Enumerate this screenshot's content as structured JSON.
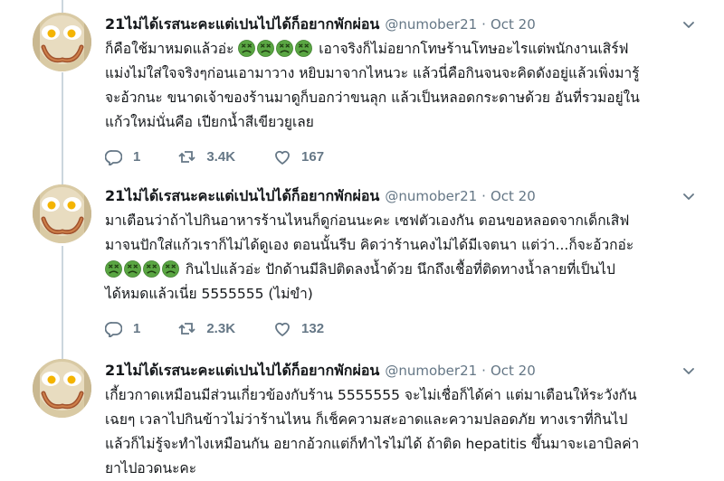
{
  "colors": {
    "text": "#14171a",
    "secondary": "#657786",
    "thread_line": "#ccd6dd"
  },
  "tweets": [
    {
      "name": "21ไม่ได้เรสนะคะแต่เปนไปได้ก็อยากพักผ่อน",
      "handle": "@numober21",
      "date": "Oct 20",
      "lines": [
        {
          "before": "ก็คือใช้มาหมดแล้วอ่ะ ",
          "emoji_count": 4,
          "after": " เอาจริงก็ไม่อยากโทษร้านโทษอะไรแต่พนักงานเสิร์ฟ"
        },
        {
          "before": "แม่งไม่ใส่ใจจริงๆก่อนเอามาวาง หยิบมาจากไหนวะ แล้วนี่คือกินจนจะคิดดังอยู่แล้วเพิ่งมารู้",
          "emoji_count": 0,
          "after": ""
        },
        {
          "before": "จะอ้วกนะ ขนาดเจ้าของร้านมาดูก็บอกว่าขนลุก แล้วเป็นหลอดกระดาษด้วย อันที่รวมอยู่ใน",
          "emoji_count": 0,
          "after": ""
        },
        {
          "before": "แก้วใหม่นั่นคือ เปียกน้ำสีเขียวยูเลย",
          "emoji_count": 0,
          "after": ""
        }
      ],
      "replies": "1",
      "retweets": "3.4K",
      "likes": "167"
    },
    {
      "name": "21ไม่ได้เรสนะคะแต่เปนไปได้ก็อยากพักผ่อน",
      "handle": "@numober21",
      "date": "Oct 20",
      "lines": [
        {
          "before": "มาเตือนว่าถ้าไปกินอาหารร้านไหนก็ดูก่อนนะคะ เซฟตัวเองกัน ตอนขอหลอดจากเด็กเสิฟ",
          "emoji_count": 0,
          "after": ""
        },
        {
          "before": "มาจนปักใส่แก้วเราก็ไม่ได้ดูเอง ตอนนั้นรีบ คิดว่าร้านคงไม่ได้มีเจตนา แต่ว่า...ก็จะอ้วกอ่ะ",
          "emoji_count": 0,
          "after": ""
        },
        {
          "before": "",
          "emoji_count": 4,
          "after": " กินไปแล้วอ่ะ ปักด้านมีลิปติดลงน้ำด้วย นึกถึงเชื้อที่ติดทางน้ำลายที่เป็นไป"
        },
        {
          "before": "ได้หมดแล้วเนี่ย 5555555 (ไม่ขำ)",
          "emoji_count": 0,
          "after": ""
        }
      ],
      "replies": "1",
      "retweets": "2.3K",
      "likes": "132"
    },
    {
      "name": "21ไม่ได้เรสนะคะแต่เปนไปได้ก็อยากพักผ่อน",
      "handle": "@numober21",
      "date": "Oct 20",
      "lines": [
        {
          "before": "เกี้ยวกาดเหมือนมีส่วนเกี่ยวข้องกับร้าน 5555555 จะไม่เชื่อก็ได้ค่า แต่มาเตือนให้ระวังกัน",
          "emoji_count": 0,
          "after": ""
        },
        {
          "before": "เฉยๆ เวลาไปกินข้าวไม่ว่าร้านไหน ก็เช็คความสะอาดและความปลอดภัย ทางเราที่กินไป",
          "emoji_count": 0,
          "after": ""
        },
        {
          "before": "แล้วก็ไม่รู้จะทำไงเหมือนกัน อยากอ้วกแต่ก็ทำไรไม่ได้ ถ้าติด hepatitis ขึ้นมาจะเอาบิลค่า",
          "emoji_count": 0,
          "after": ""
        },
        {
          "before": "ยาไปอวดนะคะ",
          "emoji_count": 0,
          "after": ""
        }
      ]
    }
  ]
}
